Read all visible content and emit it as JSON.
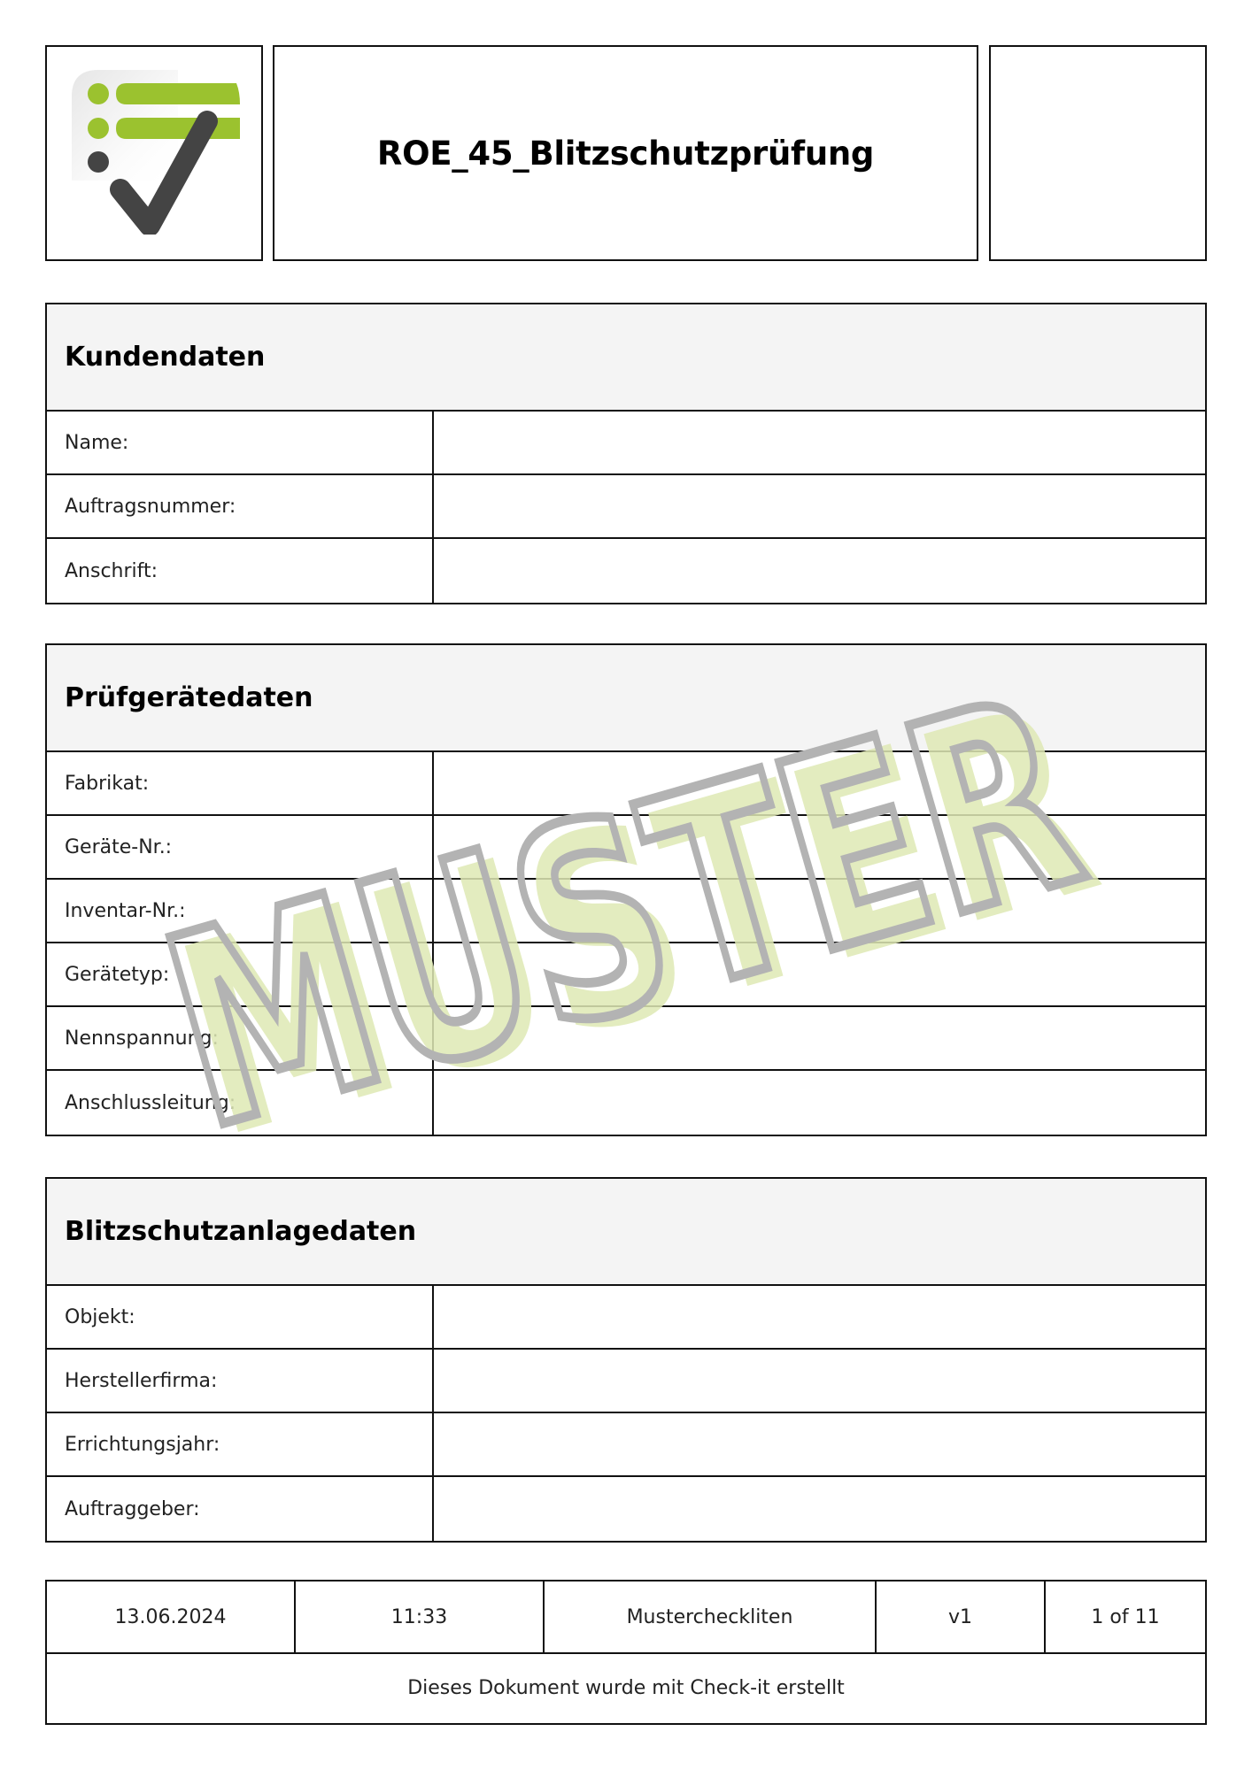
{
  "header": {
    "logo_icon": "checklist-checkmark-logo",
    "title": "ROE_45_Blitzschutzprüfung",
    "right_box": ""
  },
  "colors": {
    "logo_green": "#9bc22f",
    "logo_dark": "#444444",
    "section_header_bg": "#f4f4f4",
    "watermark_fill": "#dfe9b5",
    "watermark_outline": "#b3b3b3"
  },
  "sections": [
    {
      "title": "Kundendaten",
      "rows": [
        {
          "label": "Name:",
          "value": ""
        },
        {
          "label": "Auftragsnummer:",
          "value": ""
        },
        {
          "label": "Anschrift:",
          "value": ""
        }
      ]
    },
    {
      "title": "Prüfgerätedaten",
      "rows": [
        {
          "label": "Fabrikat:",
          "value": ""
        },
        {
          "label": "Geräte-Nr.:",
          "value": ""
        },
        {
          "label": "Inventar-Nr.:",
          "value": ""
        },
        {
          "label": "Gerätetyp:",
          "value": ""
        },
        {
          "label": "Nennspannung:",
          "value": ""
        },
        {
          "label": "Anschlussleitung:",
          "value": ""
        }
      ]
    },
    {
      "title": "Blitzschutzanlagedaten",
      "rows": [
        {
          "label": "Objekt:",
          "value": ""
        },
        {
          "label": "Herstellerfirma:",
          "value": ""
        },
        {
          "label": "Errichtungsjahr:",
          "value": ""
        },
        {
          "label": "Auftraggeber:",
          "value": ""
        }
      ]
    }
  ],
  "footer": {
    "date": "13.06.2024",
    "time": "11:33",
    "folder": "Mustercheckliten",
    "version": "v1",
    "page": "1 of 11",
    "note": "Dieses Dokument wurde mit Check-it erstellt"
  },
  "watermark": {
    "text": "MUSTER"
  }
}
